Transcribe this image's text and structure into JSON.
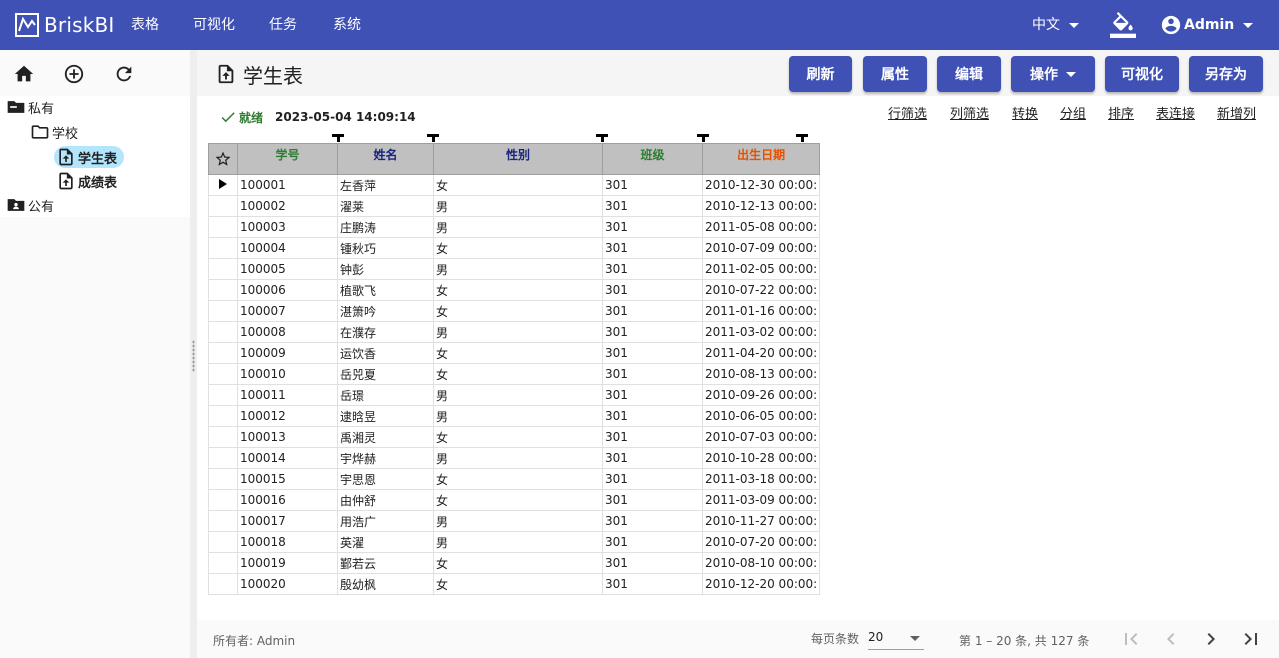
{
  "app": {
    "name": "BriskBI"
  },
  "nav": {
    "items": [
      "表格",
      "可视化",
      "任务",
      "系统"
    ]
  },
  "topbar": {
    "language": "中文",
    "user": "Admin"
  },
  "sidebar": {
    "tree": {
      "private": "私有",
      "folder": "学校",
      "items": [
        "学生表",
        "成绩表"
      ],
      "selected": "学生表",
      "public": "公有"
    }
  },
  "page": {
    "title": "学生表"
  },
  "toolbar": {
    "refresh": "刷新",
    "properties": "属性",
    "edit": "编辑",
    "operations": "操作",
    "visualize": "可视化",
    "save_as": "另存为"
  },
  "status": {
    "text": "就绪",
    "time": "2023-05-04 14:09:14"
  },
  "actions": [
    "行筛选",
    "列筛选",
    "转换",
    "分组",
    "排序",
    "表连接",
    "新增列"
  ],
  "table": {
    "columns": [
      {
        "label": "学号",
        "color": "#2e7d32"
      },
      {
        "label": "姓名",
        "color": "#1a237e"
      },
      {
        "label": "性别",
        "color": "#1a237e"
      },
      {
        "label": "班级",
        "color": "#2e7d32"
      },
      {
        "label": "出生日期",
        "color": "#e65100"
      }
    ],
    "rows": [
      [
        "100001",
        "左香萍",
        "女",
        "301",
        "2010-12-30 00:00:"
      ],
      [
        "100002",
        "濯莱",
        "男",
        "301",
        "2010-12-13 00:00:"
      ],
      [
        "100003",
        "庄鹏涛",
        "男",
        "301",
        "2011-05-08 00:00:"
      ],
      [
        "100004",
        "锺秋巧",
        "女",
        "301",
        "2010-07-09 00:00:"
      ],
      [
        "100005",
        "钟彭",
        "男",
        "301",
        "2011-02-05 00:00:"
      ],
      [
        "100006",
        "植歌飞",
        "女",
        "301",
        "2010-07-22 00:00:"
      ],
      [
        "100007",
        "湛箫吟",
        "女",
        "301",
        "2011-01-16 00:00:"
      ],
      [
        "100008",
        "在濮存",
        "男",
        "301",
        "2011-03-02 00:00:"
      ],
      [
        "100009",
        "运饮香",
        "女",
        "301",
        "2011-04-20 00:00:"
      ],
      [
        "100010",
        "岳兕夏",
        "女",
        "301",
        "2010-08-13 00:00:"
      ],
      [
        "100011",
        "岳璟",
        "男",
        "301",
        "2010-09-26 00:00:"
      ],
      [
        "100012",
        "逮晗昱",
        "男",
        "301",
        "2010-06-05 00:00:"
      ],
      [
        "100013",
        "禹湘灵",
        "女",
        "301",
        "2010-07-03 00:00:"
      ],
      [
        "100014",
        "宇烨赫",
        "男",
        "301",
        "2010-10-28 00:00:"
      ],
      [
        "100015",
        "宇思恩",
        "女",
        "301",
        "2011-03-18 00:00:"
      ],
      [
        "100016",
        "由仲舒",
        "女",
        "301",
        "2011-03-09 00:00:"
      ],
      [
        "100017",
        "用浩广",
        "男",
        "301",
        "2010-11-27 00:00:"
      ],
      [
        "100018",
        "英濯",
        "男",
        "301",
        "2010-07-20 00:00:"
      ],
      [
        "100019",
        "鄞若云",
        "女",
        "301",
        "2010-08-10 00:00:"
      ],
      [
        "100020",
        "殷幼枫",
        "女",
        "301",
        "2010-12-20 00:00:"
      ]
    ],
    "current_row": 0
  },
  "footer": {
    "owner": "所有者: Admin",
    "per_page_label": "每页条数",
    "per_page": "20",
    "range": "第 1 – 20 条, 共 127 条"
  },
  "icons": {
    "logo": "line-chart-icon",
    "paint": "format-color-fill-icon",
    "user": "account-circle-icon",
    "home": "home-icon",
    "add": "add-circle-outline-icon",
    "refresh": "refresh-icon"
  },
  "colors": {
    "primary": "#3f51b5",
    "status_ok": "#2e7d32",
    "selection": "#b3e5fc",
    "header_bg": "#c0c0c0"
  }
}
